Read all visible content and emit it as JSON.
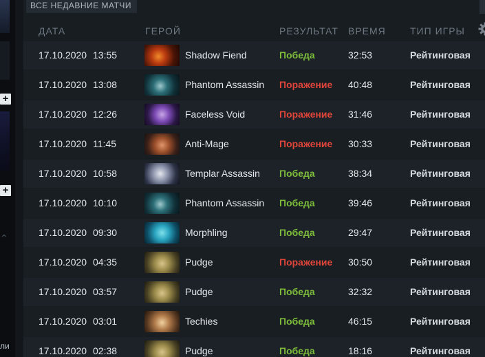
{
  "section_title": "ВСЕ НЕДАВНИЕ МАТЧИ",
  "sidebar": {
    "fragment_text": "ли"
  },
  "columns": {
    "date": "ДАТА",
    "hero": "ГЕРОЙ",
    "result": "РЕЗУЛЬТАТ",
    "duration": "ВРЕМЯ",
    "game_type": "ТИП ИГРЫ"
  },
  "colors": {
    "win": "#7cbc3a",
    "loss": "#e0453a"
  },
  "matches": [
    {
      "date": "17.10.2020",
      "time": "13:55",
      "hero": "Shadow Fiend",
      "hero_icon": "shadow-fiend-portrait",
      "result": "Победа",
      "outcome": "win",
      "duration": "32:53",
      "game_type": "Рейтинговая"
    },
    {
      "date": "17.10.2020",
      "time": "13:08",
      "hero": "Phantom Assassin",
      "hero_icon": "phantom-assassin-portrait",
      "result": "Поражение",
      "outcome": "loss",
      "duration": "40:48",
      "game_type": "Рейтинговая"
    },
    {
      "date": "17.10.2020",
      "time": "12:26",
      "hero": "Faceless Void",
      "hero_icon": "faceless-void-portrait",
      "result": "Поражение",
      "outcome": "loss",
      "duration": "31:46",
      "game_type": "Рейтинговая"
    },
    {
      "date": "17.10.2020",
      "time": "11:45",
      "hero": "Anti-Mage",
      "hero_icon": "anti-mage-portrait",
      "result": "Поражение",
      "outcome": "loss",
      "duration": "30:33",
      "game_type": "Рейтинговая"
    },
    {
      "date": "17.10.2020",
      "time": "10:58",
      "hero": "Templar Assassin",
      "hero_icon": "templar-assassin-portrait",
      "result": "Победа",
      "outcome": "win",
      "duration": "38:34",
      "game_type": "Рейтинговая"
    },
    {
      "date": "17.10.2020",
      "time": "10:10",
      "hero": "Phantom Assassin",
      "hero_icon": "phantom-assassin-portrait",
      "result": "Победа",
      "outcome": "win",
      "duration": "39:46",
      "game_type": "Рейтинговая"
    },
    {
      "date": "17.10.2020",
      "time": "09:30",
      "hero": "Morphling",
      "hero_icon": "morphling-portrait",
      "result": "Победа",
      "outcome": "win",
      "duration": "29:47",
      "game_type": "Рейтинговая"
    },
    {
      "date": "17.10.2020",
      "time": "04:35",
      "hero": "Pudge",
      "hero_icon": "pudge-portrait",
      "result": "Поражение",
      "outcome": "loss",
      "duration": "30:50",
      "game_type": "Рейтинговая"
    },
    {
      "date": "17.10.2020",
      "time": "03:57",
      "hero": "Pudge",
      "hero_icon": "pudge-portrait",
      "result": "Победа",
      "outcome": "win",
      "duration": "32:32",
      "game_type": "Рейтинговая"
    },
    {
      "date": "17.10.2020",
      "time": "03:01",
      "hero": "Techies",
      "hero_icon": "techies-portrait",
      "result": "Победа",
      "outcome": "win",
      "duration": "46:15",
      "game_type": "Рейтинговая"
    },
    {
      "date": "17.10.2020",
      "time": "02:38",
      "hero": "Pudge",
      "hero_icon": "pudge-portrait",
      "result": "Победа",
      "outcome": "win",
      "duration": "18:16",
      "game_type": "Рейтинговая"
    }
  ]
}
